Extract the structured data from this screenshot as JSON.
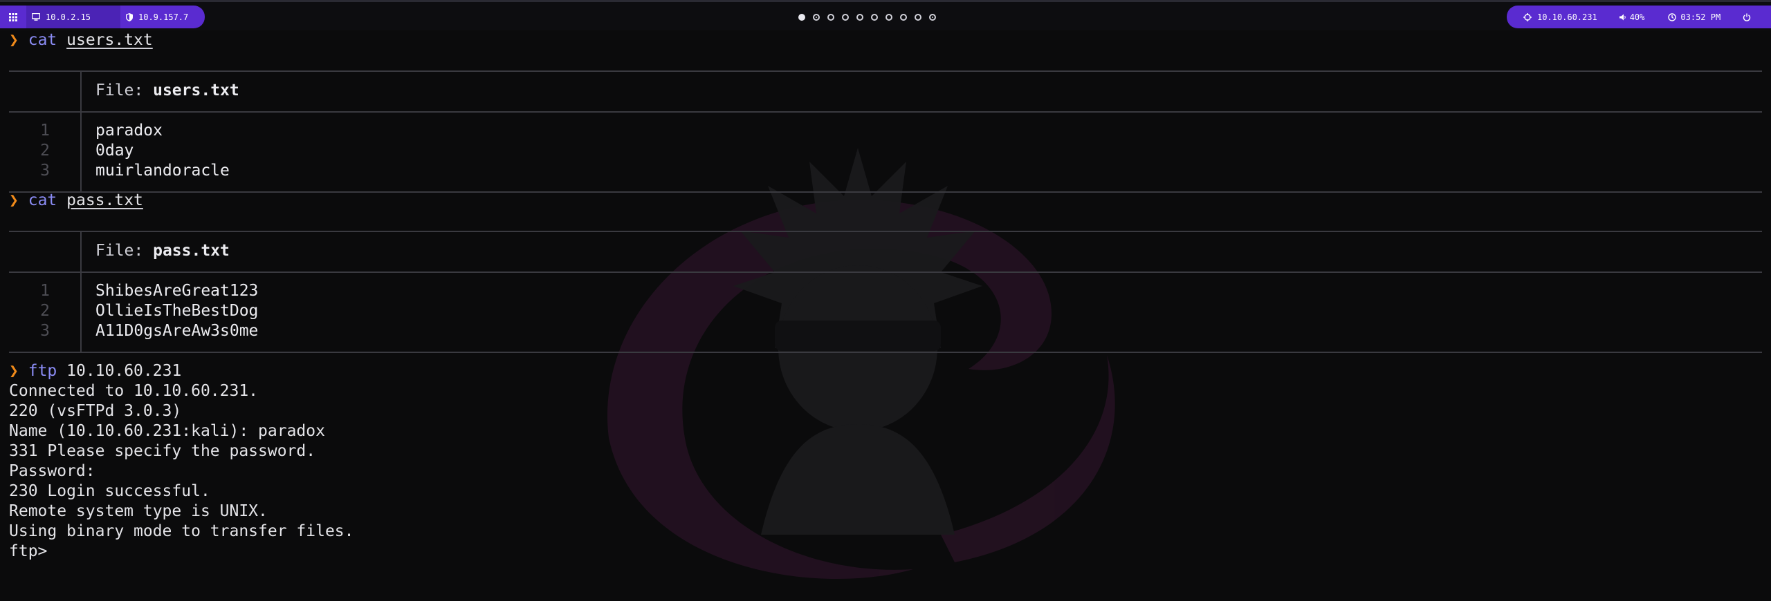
{
  "topbar": {
    "left": {
      "menu_icon": "grid-icon",
      "host_ip_icon": "monitor-icon",
      "host_ip": "10.0.2.15",
      "vpn_ip_icon": "shield-icon",
      "vpn_ip": "10.9.157.7"
    },
    "workspaces": [
      {
        "state": "active"
      },
      {
        "state": "occupied"
      },
      {
        "state": "empty"
      },
      {
        "state": "empty"
      },
      {
        "state": "empty"
      },
      {
        "state": "empty"
      },
      {
        "state": "empty"
      },
      {
        "state": "empty"
      },
      {
        "state": "empty"
      },
      {
        "state": "occupied"
      }
    ],
    "right": {
      "target_icon": "crosshair-icon",
      "target_ip": "10.10.60.231",
      "volume_icon": "speaker-icon",
      "volume": "40%",
      "clock_icon": "clock-icon",
      "time": "03:52 PM",
      "power_icon": "power-icon"
    },
    "accent_color": "#5a2bd0"
  },
  "terminal": {
    "prompt_symbol": "❯",
    "prompt_color": "#f08a1a",
    "command_color": "#8b8cf5",
    "block1": {
      "command": "cat",
      "argument": "users.txt",
      "file_label": "File:",
      "file_name": "users.txt",
      "lines": [
        {
          "num": "1",
          "text": "paradox"
        },
        {
          "num": "2",
          "text": "0day"
        },
        {
          "num": "3",
          "text": "muirlandoracle"
        }
      ]
    },
    "block2": {
      "command": "cat",
      "argument": "pass.txt",
      "file_label": "File:",
      "file_name": "pass.txt",
      "lines": [
        {
          "num": "1",
          "text": "ShibesAreGreat123"
        },
        {
          "num": "2",
          "text": "OllieIsTheBestDog"
        },
        {
          "num": "3",
          "text": "A11D0gsAreAw3s0me"
        }
      ]
    },
    "block3": {
      "command": "ftp",
      "argument": "10.10.60.231",
      "output": [
        "Connected to 10.10.60.231.",
        "220 (vsFTPd 3.0.3)",
        "Name (10.10.60.231:kali): paradox",
        "331 Please specify the password.",
        "Password:",
        "230 Login successful.",
        "Remote system type is UNIX.",
        "Using binary mode to transfer files.",
        "ftp>"
      ]
    }
  }
}
